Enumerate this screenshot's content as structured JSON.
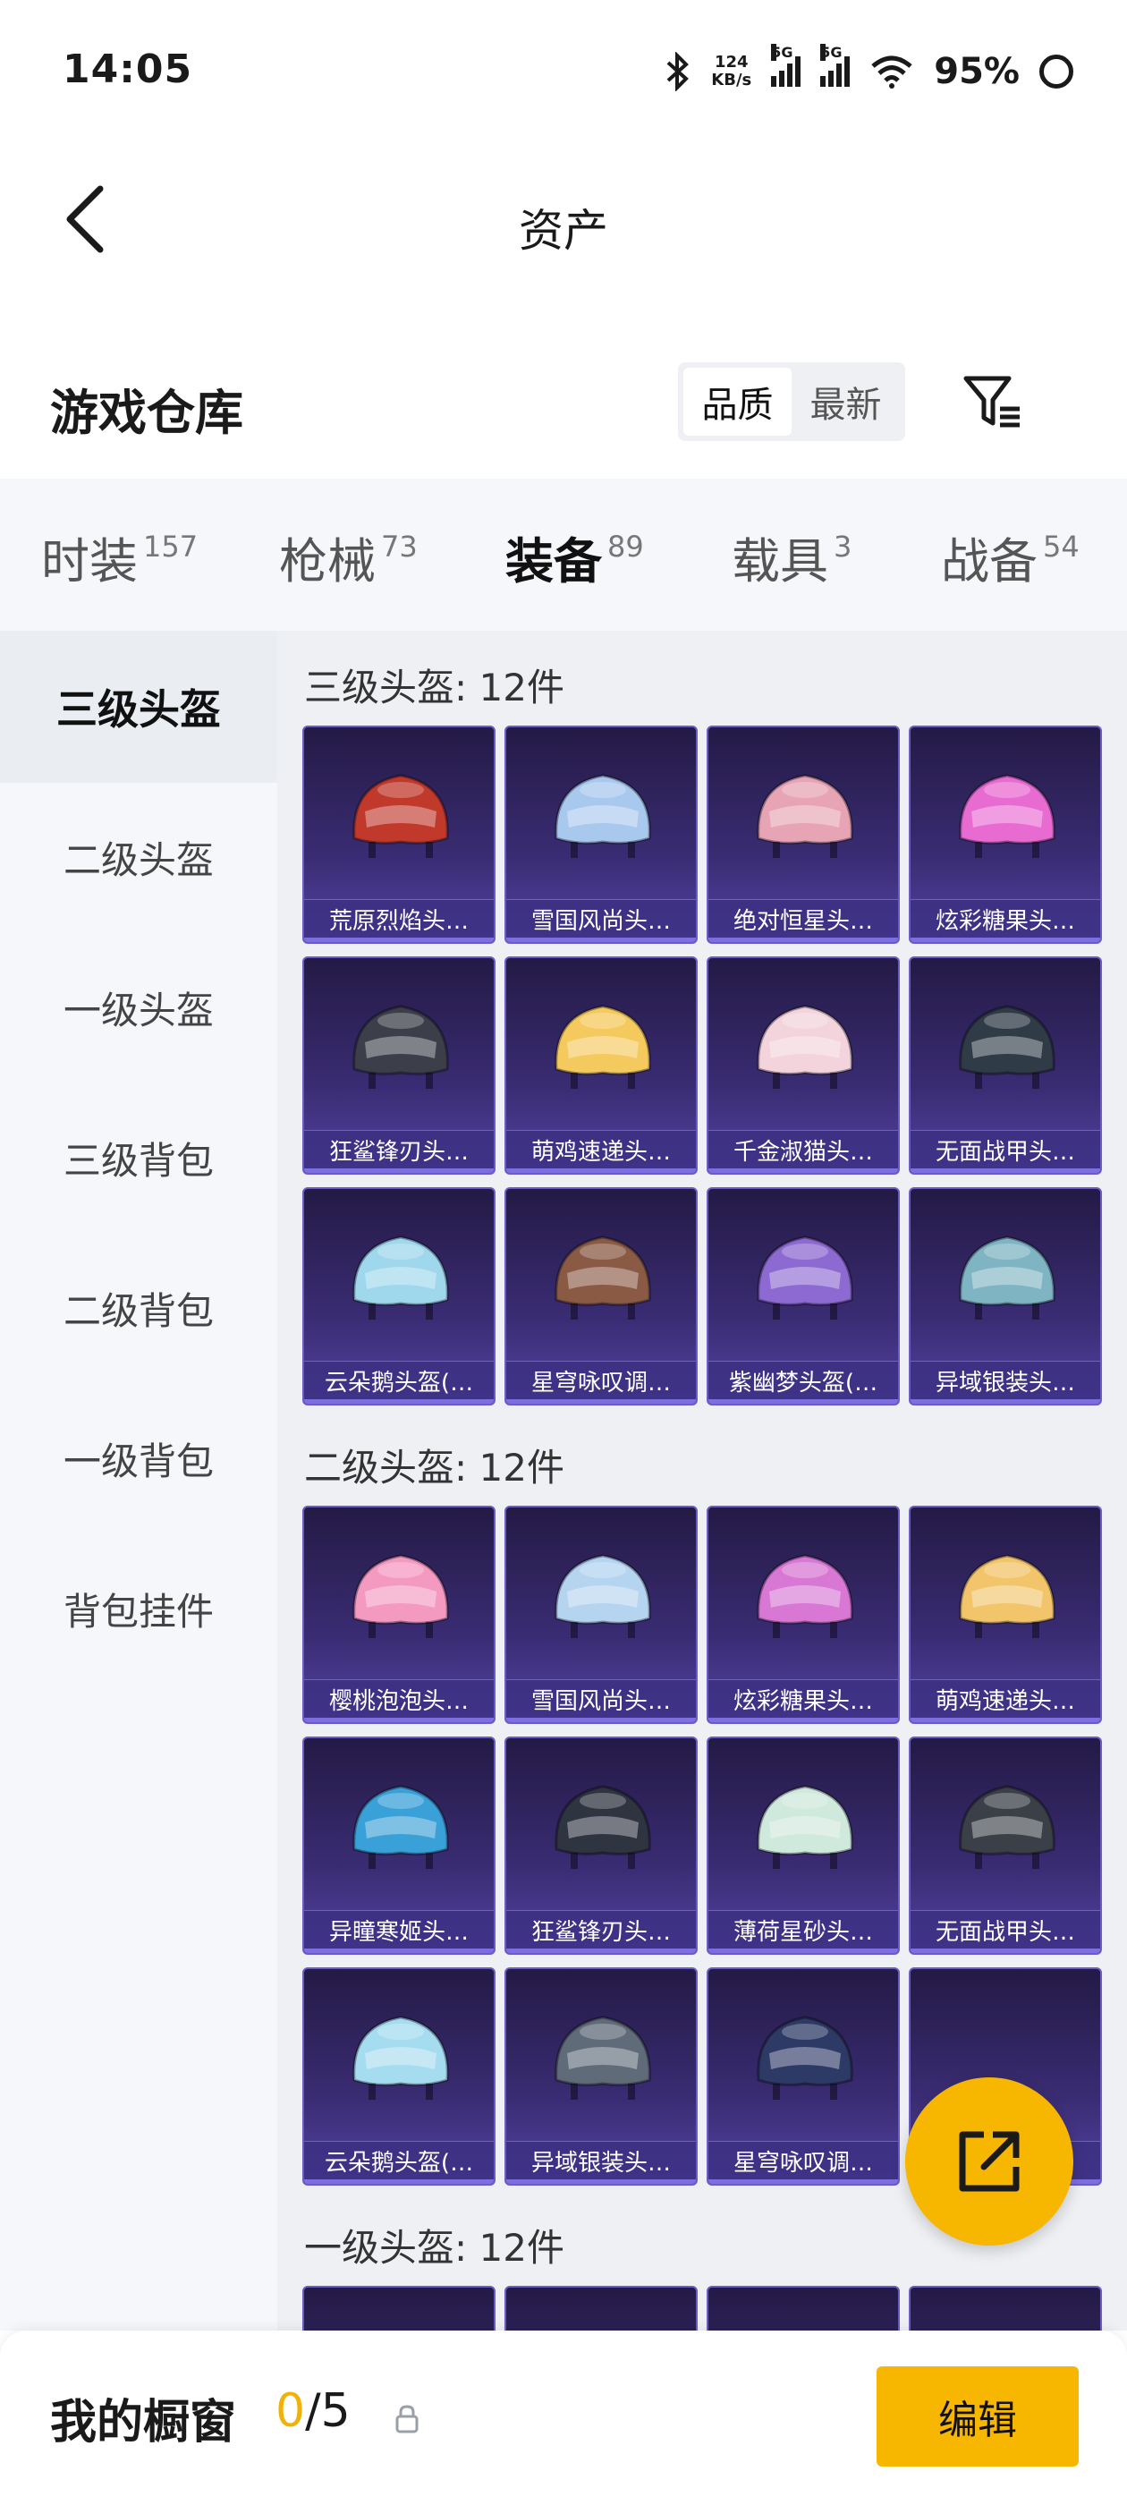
{
  "status_bar": {
    "time": "14:05",
    "speed_value": "124",
    "speed_unit": "KB/s",
    "sig1": "5G",
    "sig2": "5G",
    "battery": "95%"
  },
  "nav": {
    "title": "资产"
  },
  "header": {
    "title": "游戏仓库",
    "sort_quality": "品质",
    "sort_latest": "最新"
  },
  "tabs": [
    {
      "label": "时装",
      "count": "157"
    },
    {
      "label": "枪械",
      "count": "73"
    },
    {
      "label": "装备",
      "count": "89"
    },
    {
      "label": "载具",
      "count": "3"
    },
    {
      "label": "战备",
      "count": "54"
    }
  ],
  "sidebar": {
    "items": [
      {
        "label": "三级头盔"
      },
      {
        "label": "二级头盔"
      },
      {
        "label": "一级头盔"
      },
      {
        "label": "三级背包"
      },
      {
        "label": "二级背包"
      },
      {
        "label": "一级背包"
      },
      {
        "label": "背包挂件"
      }
    ]
  },
  "sections": [
    {
      "title": "三级头盔: 12件",
      "items": [
        {
          "name": "荒原烈焰头…",
          "color": "#c0392b"
        },
        {
          "name": "雪国风尚头…",
          "color": "#a9c8ee"
        },
        {
          "name": "绝对恒星头…",
          "color": "#e6a4b4"
        },
        {
          "name": "炫彩糖果头…",
          "color": "#e86bd1"
        },
        {
          "name": "狂鲨锋刃头…",
          "color": "#3c3f4a"
        },
        {
          "name": "萌鸡速递头…",
          "color": "#f4c95d"
        },
        {
          "name": "千金淑猫头…",
          "color": "#f3d3dc"
        },
        {
          "name": "无面战甲头…",
          "color": "#2f3b47"
        },
        {
          "name": "云朵鹅头盔(…",
          "color": "#9fd7ec"
        },
        {
          "name": "星穹咏叹调…",
          "color": "#8a5a44"
        },
        {
          "name": "紫幽梦头盔(…",
          "color": "#8c6ad1"
        },
        {
          "name": "异域银装头…",
          "color": "#7fb4c2"
        }
      ]
    },
    {
      "title": "二级头盔: 12件",
      "items": [
        {
          "name": "樱桃泡泡头…",
          "color": "#f49ac1"
        },
        {
          "name": "雪国风尚头…",
          "color": "#b5d4f0"
        },
        {
          "name": "炫彩糖果头…",
          "color": "#d878d4"
        },
        {
          "name": "萌鸡速递头…",
          "color": "#f2c56a"
        },
        {
          "name": "异瞳寒姬头…",
          "color": "#3aa0d8"
        },
        {
          "name": "狂鲨锋刃头…",
          "color": "#2e3440"
        },
        {
          "name": "薄荷星砂头…",
          "color": "#cfe9dc"
        },
        {
          "name": "无面战甲头…",
          "color": "#3b4048"
        },
        {
          "name": "云朵鹅头盔(…",
          "color": "#a6dcef"
        },
        {
          "name": "异域银装头…",
          "color": "#5f6b78"
        },
        {
          "name": "星穹咏叹调…",
          "color": "#2d3a66"
        },
        {
          "name": "",
          "color": "#3a2c73"
        }
      ]
    },
    {
      "title": "一级头盔: 12件",
      "items": []
    }
  ],
  "bottom": {
    "label": "我的橱窗",
    "count_current": "0",
    "count_total": "/5",
    "edit": "编辑"
  }
}
